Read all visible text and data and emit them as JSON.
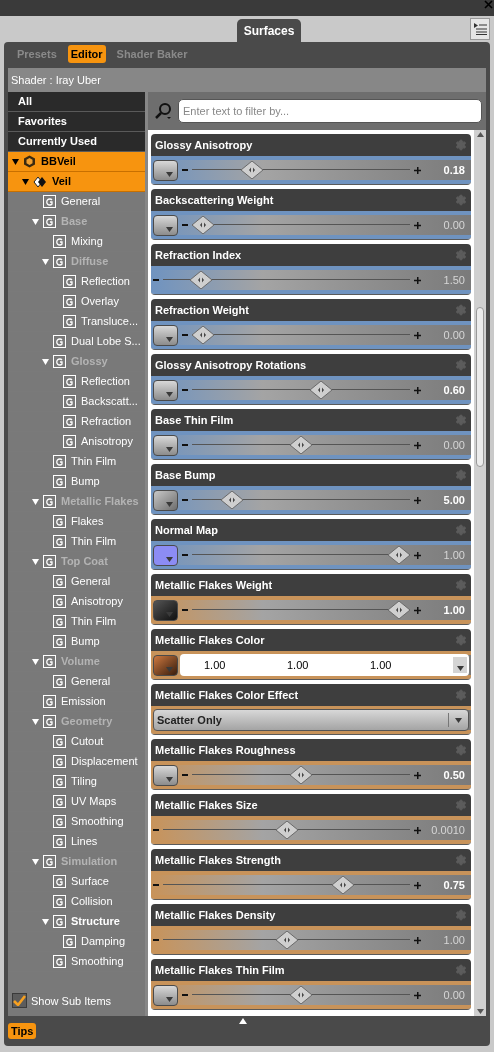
{
  "panel_tab": {
    "title": "Surfaces"
  },
  "tabs": [
    {
      "label": "Presets",
      "selected": false
    },
    {
      "label": "Editor",
      "selected": true
    },
    {
      "label": "Shader Baker",
      "selected": false
    }
  ],
  "shader": "Shader : Iray Uber",
  "filters": [
    {
      "label": "All",
      "selected": false
    },
    {
      "label": "Favorites",
      "selected": false
    },
    {
      "label": "Currently Used",
      "selected": false
    }
  ],
  "tree": [
    {
      "label": "BBVeil",
      "kind": "figure",
      "selected": true,
      "expanded": true,
      "children": [
        {
          "label": "Veil",
          "kind": "surface",
          "selected": true,
          "expanded": true,
          "children": [
            {
              "label": "General",
              "kind": "group",
              "selected": false,
              "dimmed": false
            },
            {
              "label": "Base",
              "kind": "group",
              "selected": false,
              "dimmed": true,
              "expanded": true,
              "children": [
                {
                  "label": "Mixing",
                  "kind": "group",
                  "selected": false,
                  "dimmed": false
                },
                {
                  "label": "Diffuse",
                  "kind": "group",
                  "selected": false,
                  "dimmed": true,
                  "expanded": true,
                  "children": [
                    {
                      "label": "Reflection",
                      "kind": "group",
                      "selected": false,
                      "dimmed": false
                    },
                    {
                      "label": "Overlay",
                      "kind": "group",
                      "selected": false,
                      "dimmed": false
                    },
                    {
                      "label": "Transluce...",
                      "kind": "group",
                      "selected": false,
                      "dimmed": false
                    }
                  ]
                },
                {
                  "label": "Dual Lobe S...",
                  "kind": "group",
                  "selected": false,
                  "dimmed": false
                },
                {
                  "label": "Glossy",
                  "kind": "group",
                  "selected": false,
                  "dimmed": true,
                  "expanded": true,
                  "children": [
                    {
                      "label": "Reflection",
                      "kind": "group",
                      "selected": false,
                      "dimmed": false
                    },
                    {
                      "label": "Backscatt...",
                      "kind": "group",
                      "selected": false,
                      "dimmed": false
                    },
                    {
                      "label": "Refraction",
                      "kind": "group",
                      "selected": false,
                      "dimmed": false
                    },
                    {
                      "label": "Anisotropy",
                      "kind": "group",
                      "selected": false,
                      "dimmed": false
                    }
                  ]
                },
                {
                  "label": "Thin Film",
                  "kind": "group",
                  "selected": false,
                  "dimmed": false
                },
                {
                  "label": "Bump",
                  "kind": "group",
                  "selected": false,
                  "dimmed": false
                }
              ]
            },
            {
              "label": "Metallic Flakes",
              "kind": "group",
              "selected": false,
              "dimmed": true,
              "expanded": true,
              "children": [
                {
                  "label": "Flakes",
                  "kind": "group",
                  "selected": false,
                  "dimmed": false
                },
                {
                  "label": "Thin Film",
                  "kind": "group",
                  "selected": false,
                  "dimmed": false
                }
              ]
            },
            {
              "label": "Top Coat",
              "kind": "group",
              "selected": false,
              "dimmed": true,
              "expanded": true,
              "children": [
                {
                  "label": "General",
                  "kind": "group",
                  "selected": false,
                  "dimmed": false
                },
                {
                  "label": "Anisotropy",
                  "kind": "group",
                  "selected": false,
                  "dimmed": false
                },
                {
                  "label": "Thin Film",
                  "kind": "group",
                  "selected": false,
                  "dimmed": false
                },
                {
                  "label": "Bump",
                  "kind": "group",
                  "selected": false,
                  "dimmed": false
                }
              ]
            },
            {
              "label": "Volume",
              "kind": "group",
              "selected": false,
              "dimmed": true,
              "expanded": true,
              "children": [
                {
                  "label": "General",
                  "kind": "group",
                  "selected": false,
                  "dimmed": false
                }
              ]
            },
            {
              "label": "Emission",
              "kind": "group",
              "selected": false,
              "dimmed": false
            },
            {
              "label": "Geometry",
              "kind": "group",
              "selected": false,
              "dimmed": true,
              "expanded": true,
              "children": [
                {
                  "label": "Cutout",
                  "kind": "group",
                  "selected": false,
                  "dimmed": false
                },
                {
                  "label": "Displacement",
                  "kind": "group",
                  "selected": false,
                  "dimmed": false
                },
                {
                  "label": "Tiling",
                  "kind": "group",
                  "selected": false,
                  "dimmed": false
                },
                {
                  "label": "UV Maps",
                  "kind": "group",
                  "selected": false,
                  "dimmed": false
                },
                {
                  "label": "Smoothing",
                  "kind": "group",
                  "selected": false,
                  "dimmed": false
                },
                {
                  "label": "Lines",
                  "kind": "group",
                  "selected": false,
                  "dimmed": false
                }
              ]
            },
            {
              "label": "Simulation",
              "kind": "group",
              "selected": false,
              "dimmed": true,
              "expanded": true,
              "children": [
                {
                  "label": "Surface",
                  "kind": "group",
                  "selected": false,
                  "dimmed": false
                },
                {
                  "label": "Collision",
                  "kind": "group",
                  "selected": false,
                  "dimmed": false
                },
                {
                  "label": "Structure",
                  "kind": "group",
                  "selected": false,
                  "dimmed": false,
                  "expanded": true,
                  "children": [
                    {
                      "label": "Damping",
                      "kind": "group",
                      "selected": false,
                      "dimmed": false
                    }
                  ]
                },
                {
                  "label": "Smoothing",
                  "kind": "group",
                  "selected": false,
                  "dimmed": false
                }
              ]
            }
          ]
        }
      ]
    }
  ],
  "show_sub_items": {
    "label": "Show Sub Items",
    "checked": true
  },
  "tips": "Tips",
  "search": {
    "placeholder": "Enter text to filter by..."
  },
  "properties": [
    {
      "name": "Glossy Anisotropy",
      "kind": "slider",
      "color": "#6f93c0",
      "map": {
        "kind": "none"
      },
      "level": 0.25,
      "reading": "0.18",
      "modified": true
    },
    {
      "name": "Backscattering Weight",
      "kind": "slider",
      "color": "#6f93c0",
      "map": {
        "kind": "none"
      },
      "level": 0.0,
      "reading": "0.00",
      "modified": false
    },
    {
      "name": "Refraction Index",
      "kind": "slider",
      "color": "#6f93c0",
      "level": 0.12,
      "reading": "1.50",
      "modified": false
    },
    {
      "name": "Refraction Weight",
      "kind": "slider",
      "color": "#6f93c0",
      "map": {
        "kind": "none"
      },
      "level": 0.0,
      "reading": "0.00",
      "modified": false
    },
    {
      "name": "Glossy Anisotropy Rotations",
      "kind": "slider",
      "color": "#6f93c0",
      "map": {
        "kind": "none"
      },
      "level": 0.6,
      "reading": "0.60",
      "modified": true
    },
    {
      "name": "Base Thin Film",
      "kind": "slider",
      "color": "#6f93c0",
      "map": {
        "kind": "none"
      },
      "level": 0.5,
      "reading": "0.00",
      "modified": false
    },
    {
      "name": "Base Bump",
      "kind": "slider",
      "color": "#6f93c0",
      "map": {
        "kind": "texture"
      },
      "level": 0.15,
      "reading": "5.00",
      "modified": true
    },
    {
      "name": "Normal Map",
      "kind": "slider",
      "color": "#6f93c0",
      "map": {
        "kind": "normal"
      },
      "level": 1.0,
      "reading": "1.00",
      "modified": false
    },
    {
      "name": "Metallic Flakes Weight",
      "kind": "slider",
      "color": "#c8935a",
      "map": {
        "kind": "dark"
      },
      "level": 1.0,
      "reading": "1.00",
      "modified": true
    },
    {
      "name": "Metallic Flakes Color",
      "kind": "color",
      "color": "#c8935a",
      "map": {
        "kind": "copper"
      },
      "values": [
        "1.00",
        "1.00",
        "1.00"
      ]
    },
    {
      "name": "Metallic Flakes Color Effect",
      "kind": "dropdown",
      "color": "#c8935a",
      "value": "Scatter Only"
    },
    {
      "name": "Metallic Flakes Roughness",
      "kind": "slider",
      "color": "#c8935a",
      "map": {
        "kind": "none"
      },
      "level": 0.5,
      "reading": "0.50",
      "modified": true
    },
    {
      "name": "Metallic Flakes Size",
      "kind": "slider",
      "color": "#c8935a",
      "level": 0.5,
      "reading": "0.0010",
      "modified": false
    },
    {
      "name": "Metallic Flakes Strength",
      "kind": "slider",
      "color": "#c8935a",
      "level": 0.75,
      "reading": "0.75",
      "modified": true
    },
    {
      "name": "Metallic Flakes Density",
      "kind": "slider",
      "color": "#c8935a",
      "level": 0.5,
      "reading": "1.00",
      "modified": false
    },
    {
      "name": "Metallic Flakes Thin Film",
      "kind": "slider",
      "color": "#c8935a",
      "map": {
        "kind": "none"
      },
      "level": 0.5,
      "reading": "0.00",
      "modified": false
    }
  ]
}
